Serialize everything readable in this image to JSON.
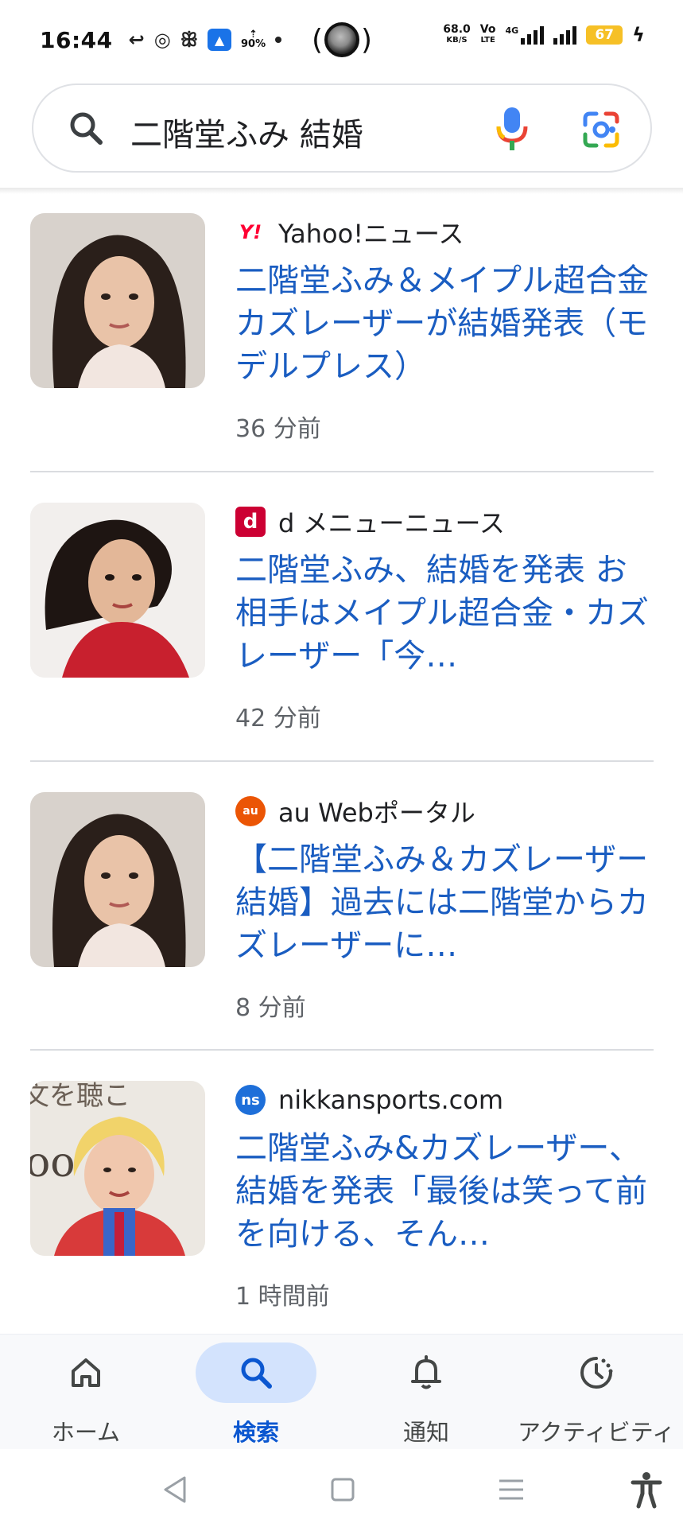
{
  "status_bar": {
    "time": "16:44",
    "upload_percent": "90%",
    "net_speed": "68.0",
    "net_speed_unit": "KB/S",
    "volte_top": "Vo",
    "volte_bottom": "LTE",
    "network_type": "4G",
    "battery_level": "67",
    "icons": [
      "reply-icon",
      "chrome-icon",
      "rabbit-icon",
      "android-icon",
      "upload-icon",
      "dot-icon",
      "coin-icon",
      "signal-icon",
      "battery-icon",
      "charging-icon"
    ]
  },
  "search": {
    "query": "二階堂ふみ 結婚",
    "icons": [
      "search-icon",
      "mic-icon",
      "lens-icon"
    ]
  },
  "news": [
    {
      "source": "Yahoo!ニュース",
      "logo_text": "Y!",
      "logo_color": "#ff0033",
      "headline": "二階堂ふみ＆メイプル超合金カズレーザーが結婚発表（モデルプレス）",
      "time": "36 分前"
    },
    {
      "source": "d メニューニュース",
      "logo_text": "d",
      "logo_color": "#cc0033",
      "headline": "二階堂ふみ、結婚を発表 お相手はメイプル超合金・カズレーザー「今…",
      "time": "42 分前"
    },
    {
      "source": "au Webポータル",
      "logo_text": "au",
      "logo_color": "#eb5505",
      "headline": "【二階堂ふみ＆カズレーザー結婚】過去には二階堂からカズレーザーに…",
      "time": "8 分前"
    },
    {
      "source": "nikkansports.com",
      "logo_text": "ns",
      "logo_color": "#1e6fd9",
      "headline": "二階堂ふみ&カズレーザー、結婚を発表「最後は笑って前を向ける、そん…",
      "time": "1 時間前"
    }
  ],
  "bottom_nav": {
    "items": [
      {
        "label": "ホーム",
        "icon": "home-icon",
        "active": false
      },
      {
        "label": "検索",
        "icon": "search-icon",
        "active": true
      },
      {
        "label": "通知",
        "icon": "bell-icon",
        "active": false
      },
      {
        "label": "アクティビティ",
        "icon": "activity-icon",
        "active": false
      }
    ]
  },
  "system_nav": {
    "buttons": [
      "back-icon",
      "home-square-icon",
      "recents-icon",
      "accessibility-icon"
    ]
  },
  "colors": {
    "link": "#1a5dc1",
    "active_nav": "#0b57d0",
    "active_pill": "#d3e3fd",
    "battery": "#f6c026"
  }
}
